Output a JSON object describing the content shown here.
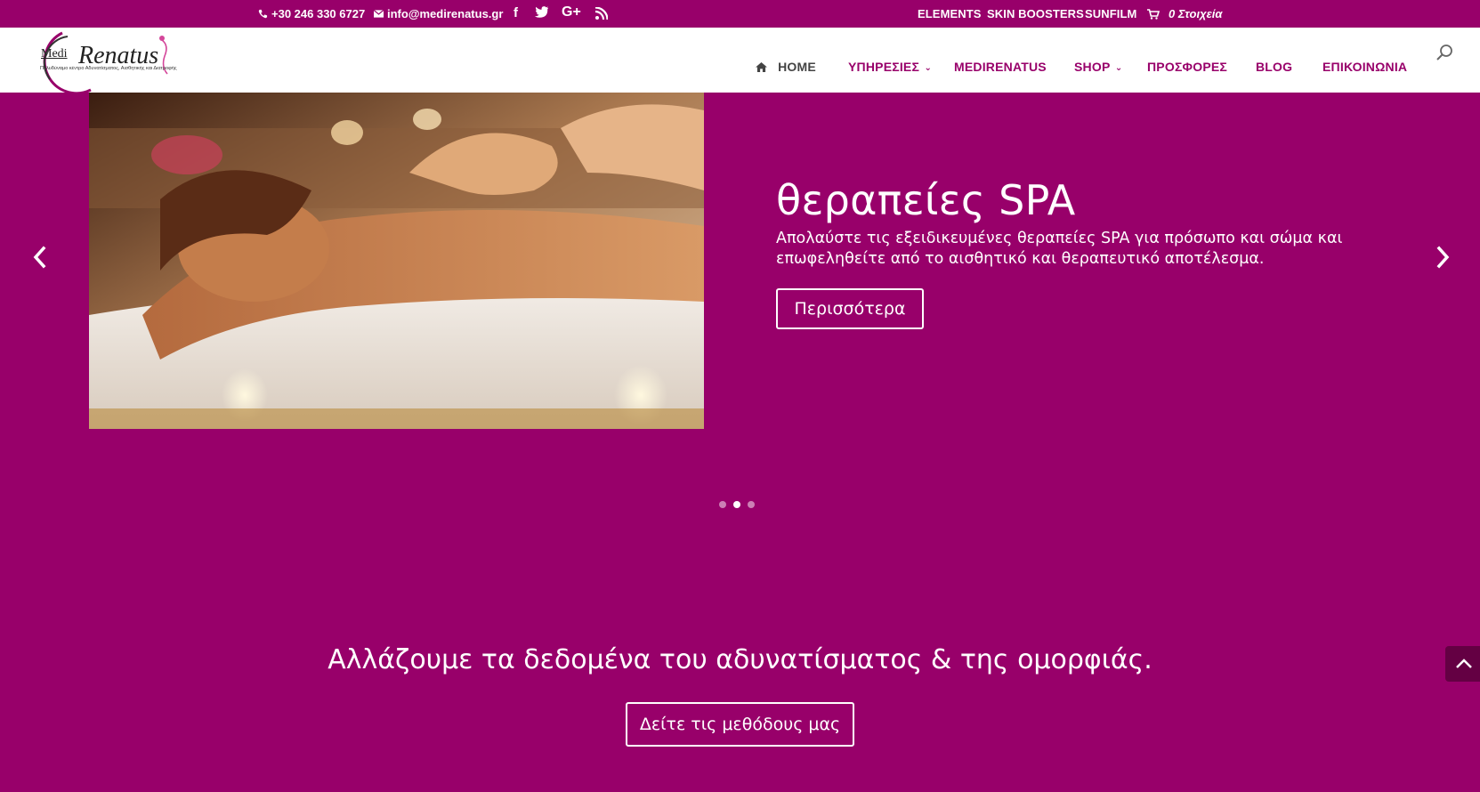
{
  "colors": {
    "brand": "#98006a",
    "header_bg": "#ffffff",
    "home_text": "#444444"
  },
  "topbar": {
    "phone": "+30 246 330 6727",
    "email": "info@medirenatus.gr",
    "social": {
      "facebook": "f",
      "twitter": "twitter-icon",
      "google_plus": "G+",
      "rss": "rss-icon"
    },
    "links": [
      "ELEMENTS",
      "SKIN BOOSTERS",
      "SUNFILM"
    ],
    "cart": "0 Στοιχεία"
  },
  "logo": {
    "word1": "Medi",
    "word2": "Renatus",
    "tagline": "Πολυδύναμο κέντρο Αδυνατίσματος, Αισθητικής και Διατροφής"
  },
  "nav": {
    "items": [
      {
        "label": "HOME",
        "icon": "home-icon"
      },
      {
        "label": "ΥΠΗΡΕΣΙΕΣ",
        "has_dropdown": true
      },
      {
        "label": "MEDIRENATUS"
      },
      {
        "label": "SHOP",
        "has_dropdown": true
      },
      {
        "label": "ΠΡΟΣΦΟΡΕΣ"
      },
      {
        "label": "BLOG"
      },
      {
        "label": "ΕΠΙΚΟΙΝΩΝΙΑ"
      }
    ],
    "search_icon": "search-icon"
  },
  "slider": {
    "title": "θεραπείες SPA",
    "description": "Απολαύστε τις εξειδικευμένες θεραπείες SPA για πρόσωπο και σώμα και επωφεληθείτε από το αισθητικό και θεραπευτικό αποτέλεσμα.",
    "button": "Περισσότερα",
    "dots_total": 3,
    "active_dot": 2
  },
  "section": {
    "tagline": "Αλλάζουμε τα δεδομένα του αδυνατίσματος & της ομορφιάς.",
    "button": "Δείτε τις μεθόδους μας"
  }
}
